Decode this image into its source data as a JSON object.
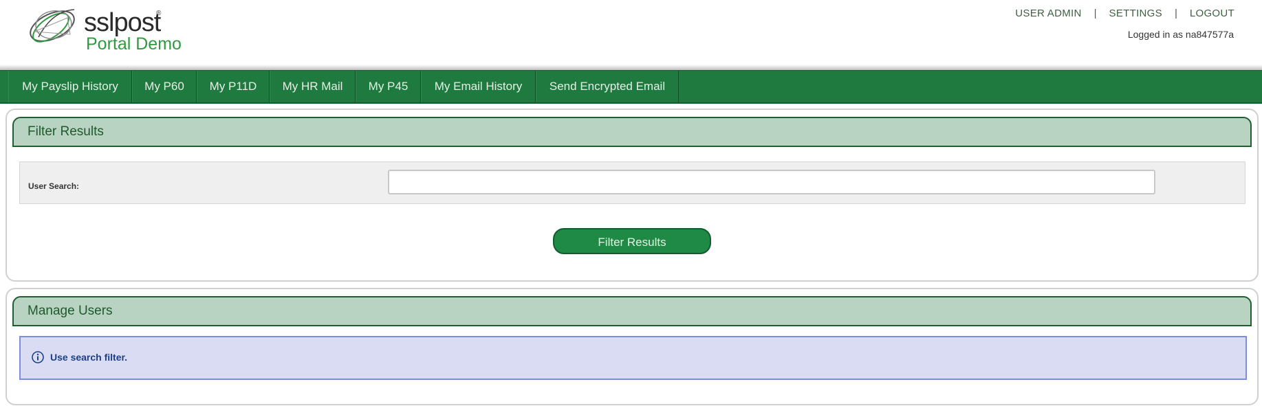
{
  "logo": {
    "name": "sslpost",
    "registered": "®",
    "subtitle": "Portal Demo"
  },
  "toplinks": {
    "user_admin": "USER ADMIN",
    "settings": "SETTINGS",
    "logout": "LOGOUT",
    "separator": "|"
  },
  "session": {
    "logged_in": "Logged in as na847577a"
  },
  "nav": {
    "items": [
      {
        "label": "My Payslip History"
      },
      {
        "label": "My P60"
      },
      {
        "label": "My P11D"
      },
      {
        "label": "My HR Mail"
      },
      {
        "label": "My P45"
      },
      {
        "label": "My Email History"
      },
      {
        "label": "Send Encrypted Email"
      }
    ]
  },
  "filter": {
    "title": "Filter Results",
    "search_label": "User Search:",
    "search_value": "",
    "button": "Filter Results"
  },
  "manage": {
    "title": "Manage Users",
    "info": "Use search filter."
  },
  "colors": {
    "nav_bg": "#1e7a3f",
    "panel_head_bg": "#b8d3c2",
    "brand_green": "#2e9a3e",
    "info_bg": "#d9dcf3"
  }
}
